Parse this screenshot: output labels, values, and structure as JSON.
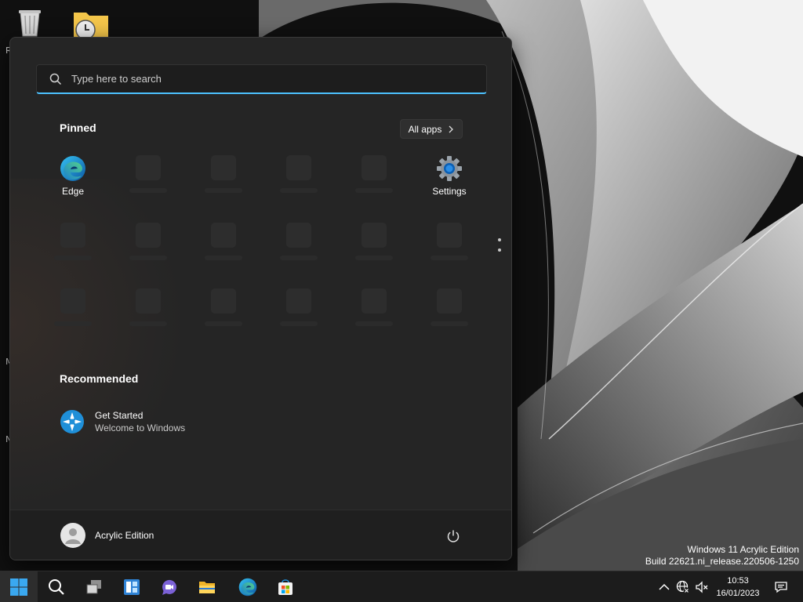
{
  "desktop": {
    "edge_letters": [
      "R",
      "M",
      "N"
    ],
    "watermark": {
      "line1": "Windows 11 Acrylic Edition",
      "line2": "Build 22621.ni_release.220506-1250"
    }
  },
  "start_menu": {
    "search": {
      "placeholder": "Type here to search",
      "icon": "search-icon"
    },
    "pinned": {
      "title": "Pinned",
      "all_apps_label": "All apps",
      "apps": [
        {
          "label": "Edge",
          "icon": "edge-icon"
        },
        {
          "label": "Settings",
          "icon": "settings-gear-icon"
        }
      ]
    },
    "recommended": {
      "title": "Recommended",
      "items": [
        {
          "name": "Get Started",
          "subtitle": "Welcome to Windows",
          "icon": "get-started-icon"
        }
      ]
    },
    "footer": {
      "user_name": "Acrylic Edition",
      "power_icon": "power-icon"
    }
  },
  "taskbar": {
    "apps": [
      "start-icon",
      "search-icon",
      "task-view-icon",
      "widgets-icon",
      "chat-icon",
      "file-explorer-icon",
      "edge-icon",
      "store-icon"
    ],
    "clock": {
      "time": "10:53",
      "date": "16/01/2023"
    },
    "accent": "#4cc2ff"
  }
}
